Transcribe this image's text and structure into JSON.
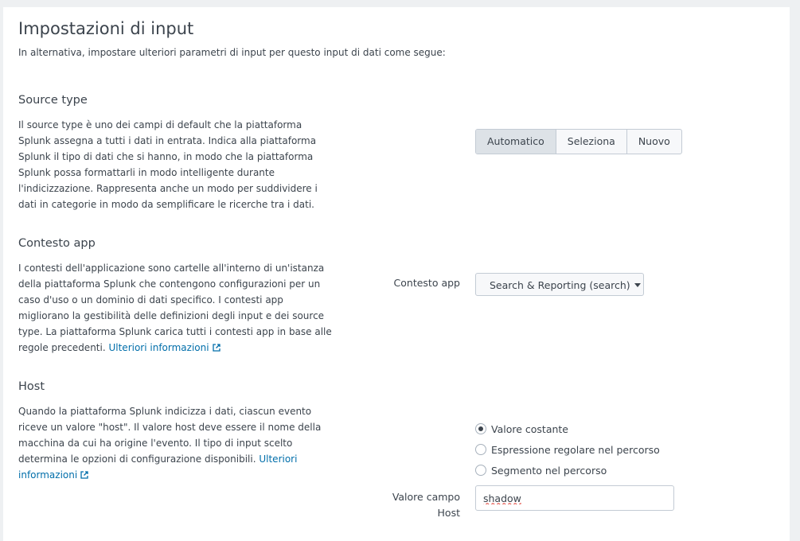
{
  "header": {
    "title": "Impostazioni di input",
    "subtitle": "In alternativa, impostare ulteriori parametri di input per questo input di dati come segue:"
  },
  "source_type": {
    "title": "Source type",
    "description_lines": [
      "Il source type è uno dei campi di default che la piattaforma",
      "Splunk assegna a tutti i dati in entrata. Indica alla piattaforma",
      "Splunk il tipo di dati che si hanno, in modo che la piattaforma",
      "Splunk possa formattarli in modo intelligente durante",
      "l'indicizzazione. Rappresenta anche un modo per suddividere i",
      "dati in categorie in modo da semplificare le ricerche tra i dati."
    ],
    "buttons": [
      "Automatico",
      "Seleziona",
      "Nuovo"
    ],
    "selected": "Automatico"
  },
  "app_context": {
    "title": "Contesto app",
    "description_lines": [
      "I contesti dell'applicazione sono cartelle all'interno di un'istanza",
      "della piattaforma Splunk che contengono configurazioni per un",
      "caso d'uso o un dominio di dati specifico. I contesti app",
      "migliorano la gestibilità delle definizioni degli input e dei source",
      "type. La piattaforma Splunk carica tutti i contesti app in base alle",
      "regole precedenti."
    ],
    "link_text": "Ulteriori informazioni",
    "field_label": "Contesto app",
    "dropdown_value": "Search & Reporting (search)"
  },
  "host": {
    "title": "Host",
    "description_lines": [
      "Quando la piattaforma Splunk indicizza i dati, ciascun evento",
      "riceve un valore \"host\". Il valore host deve essere il nome della",
      "macchina da cui ha origine l'evento. Il tipo di input scelto",
      "determina le opzioni di configurazione disponibili."
    ],
    "link_text_1": "Ulteriori",
    "link_text_2": "informazioni",
    "radio_options": [
      "Valore costante",
      "Espressione regolare nel percorso",
      "Segmento nel percorso"
    ],
    "selected_option": "Valore costante",
    "field_label_1": "Valore campo",
    "field_label_2": "Host",
    "field_value": "shadow"
  },
  "icons": {
    "external_link": "external-link-icon",
    "dropdown": "caret-down-icon"
  }
}
